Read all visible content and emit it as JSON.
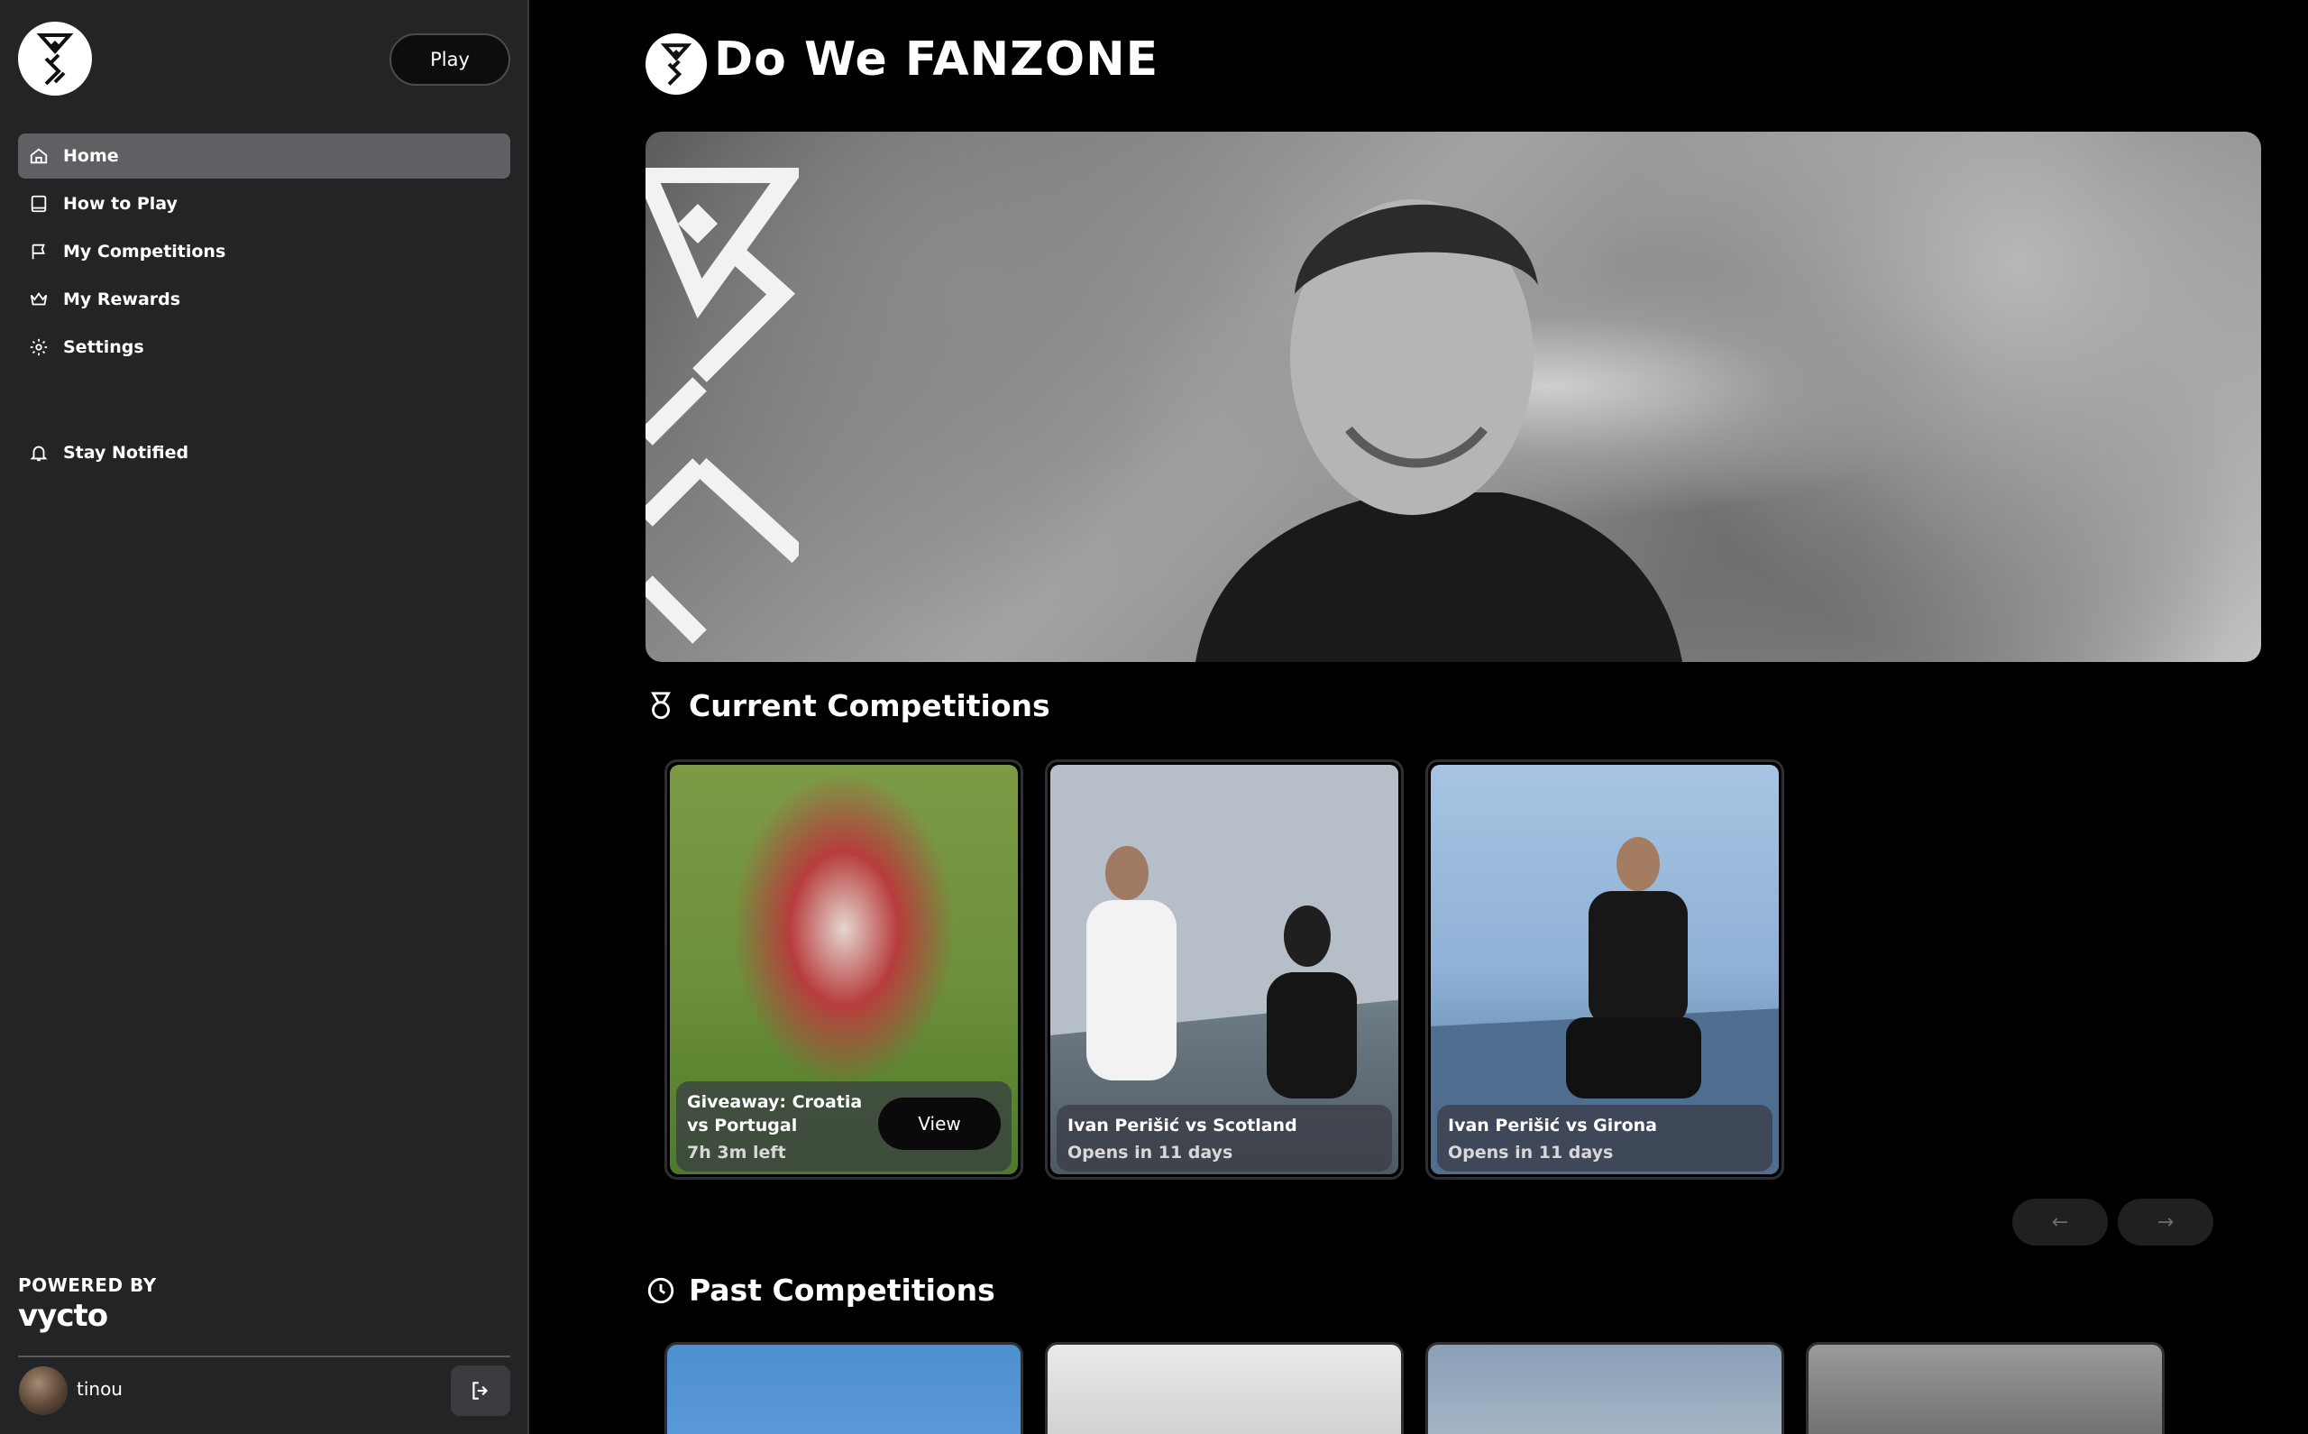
{
  "sidebar": {
    "play_label": "Play",
    "nav": [
      {
        "label": "Home",
        "icon": "home-icon",
        "active": true
      },
      {
        "label": "How to Play",
        "icon": "book-icon"
      },
      {
        "label": "My Competitions",
        "icon": "flag-icon"
      },
      {
        "label": "My Rewards",
        "icon": "crown-icon"
      },
      {
        "label": "Settings",
        "icon": "gear-icon"
      }
    ],
    "notify_label": "Stay Notified",
    "powered_by": "POWERED BY",
    "powered_brand": "vycto",
    "user": {
      "name": "tinou"
    }
  },
  "header": {
    "title": "Do We FANZONE"
  },
  "current": {
    "title": "Current Competitions",
    "cards": [
      {
        "title": "Giveaway: Croatia vs Portugal",
        "subtitle": "7h 3m left",
        "button": "View"
      },
      {
        "title": "Ivan Perišić vs Scotland",
        "subtitle": "Opens in 11 days"
      },
      {
        "title": "Ivan Perišić vs Girona",
        "subtitle": "Opens in 11 days"
      }
    ],
    "prev_label": "←",
    "next_label": "→"
  },
  "past": {
    "title": "Past Competitions"
  },
  "colors": {
    "sidebar_bg": "#232426",
    "active_nav": "#5f6064",
    "page_bg": "#000000",
    "accent_dot": "#f5b642"
  }
}
